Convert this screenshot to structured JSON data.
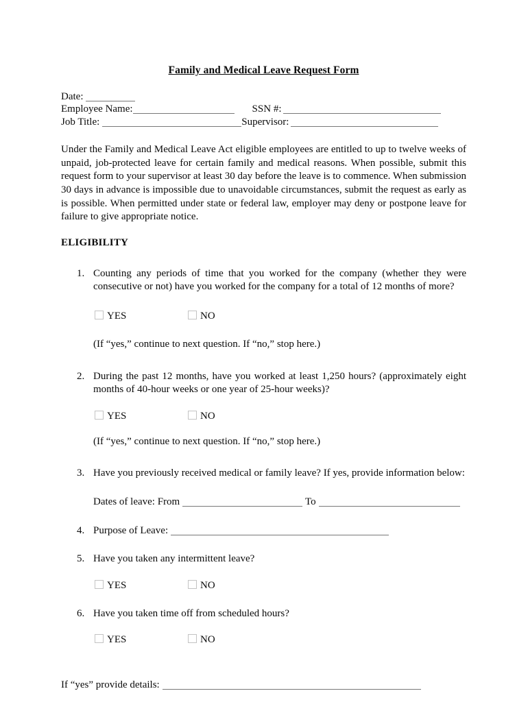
{
  "document": {
    "title": "Family and Medical Leave Request Form",
    "header_fields": {
      "date_label": "Date:",
      "employee_name_label": "Employee Name:",
      "ssn_label": "SSN #:",
      "job_title_label": "Job Title:",
      "supervisor_label": "Supervisor:"
    },
    "intro_paragraph": "Under the Family and Medical Leave Act eligible employees are entitled to up to twelve weeks of unpaid, job-protected leave for certain family and medical reasons.  When possible, submit this request form to your supervisor at least 30 day before the leave is to commence.  When submission 30 days in advance is impossible due to unavoidable circumstances, submit the request as early as is possible.  When permitted under state or federal law, employer may deny or postpone leave for failure to give appropriate notice.",
    "section_heading": "ELIGIBILITY",
    "questions": [
      {
        "number": "1.",
        "text": "Counting any periods of time that you worked for the company (whether they were consecutive or not) have you worked for the company for a total of 12 months of more?",
        "hint": " (If “yes,” continue to next question. If “no,” stop here.)"
      },
      {
        "number": "2.",
        "text": "During the past 12 months, have you worked at least 1,250 hours? (approximately eight months of 40-hour weeks or one year of 25-hour weeks)?",
        "hint": "(If “yes,” continue to next question. If “no,” stop here.)"
      },
      {
        "number": "3.",
        "text": "Have you previously received medical or family leave? If yes, provide information below:",
        "dates_label": "Dates of leave: From",
        "dates_to_label": "To"
      },
      {
        "number": "4.",
        "text": "Purpose of Leave:"
      },
      {
        "number": "5.",
        "text": "Have you taken any intermittent leave?"
      },
      {
        "number": "6.",
        "text": "Have you taken time off from scheduled hours?"
      }
    ],
    "choice_labels": {
      "yes": "YES",
      "no": "NO"
    },
    "footer": {
      "details_label": "If “yes” provide details:"
    },
    "colors": {
      "text": "#0a0a0a",
      "rule": "#777777",
      "checkbox_border": "#c3c3c3",
      "background": "#ffffff"
    }
  }
}
